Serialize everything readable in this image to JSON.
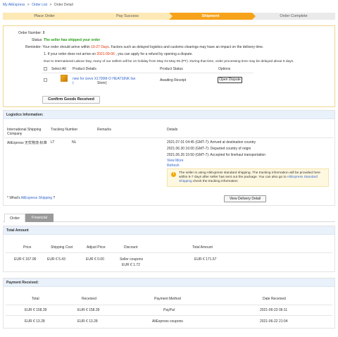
{
  "breadcrumb": [
    "My AliExpress",
    ">",
    "Order List",
    ">",
    "Order Detail"
  ],
  "steps": [
    {
      "label": "Place Order",
      "state": "done"
    },
    {
      "label": "Pay Success",
      "state": "done"
    },
    {
      "label": "Shipment",
      "state": "active"
    },
    {
      "label": "Order Complete",
      "state": "todo"
    }
  ],
  "order": {
    "number_label": "Order Number:",
    "number_value": "8",
    "status_label": "Status:",
    "status_value": "The seller has shipped your order",
    "reminder_label": "Reminder:",
    "reminder_pre": "Your order should arrive within ",
    "reminder_days": "19-27 Days",
    "reminder_post": ". Factors such as delayed logistics and customs clearings may have an impact on the delivery time.",
    "refund_pre": "1. If your order does not arrive on ",
    "refund_date": "2021-09-06",
    "refund_post": " , you can apply for a refund by opening a dispute.",
    "holiday_note": "Due to International Labour Day, many of our sellers will be on holiday from May 01-May 05 (PT). During that time, order processing time may be delayed about 5 days.",
    "confirm_button": "Confirm Goods Received"
  },
  "products": {
    "headers": [
      "Select All",
      "Product Details",
      "Product Status",
      "Options"
    ],
    "item": {
      "name_line1": "new for cievo X1700M-O HEATSINK fan",
      "name_line2": "(",
      "store": "Store)",
      "status": "Awaiting Receipt",
      "option_button": "Open Dispute"
    }
  },
  "logistics": {
    "title": "Logistics Information:",
    "headers": [
      "International Shipping Company",
      "Tracking Number",
      "Remarks",
      "Details"
    ],
    "company": "AliExpress 无忧物流-标准",
    "tracking_prefix": "LT",
    "tracking_suffix": "NL",
    "events": [
      "2021.07.01 04:45 (GMT-7): Arrived at destination country",
      "2021.06.30 16:00 (GMT-7): Departed country of origin",
      "2021.06.26 15:50 (GMT-7): Accepted for linehaul transportation"
    ],
    "view_more": "View More",
    "refresh": "Refresh",
    "tip_pre": "The seller is using AliExpress standard shipping. The tracking information will be provided here within 5-7 days after seller has sent out the package. You can also go to ",
    "tip_link": "AliExpress Standard Shipping",
    "tip_post": " check the tracking information",
    "whats_pre": "* What's ",
    "whats_link": "AliExpress Shipping",
    "whats_post": " ?",
    "view_delivery_button": "View Delivery Detail"
  },
  "tabs": [
    "Order",
    "Financial"
  ],
  "total_amount": {
    "title": "Total Amount",
    "headers": [
      "Price",
      "Shipping Cost",
      "Adjust Price",
      "Discount",
      "Total Amount"
    ],
    "price": "EUR € 167.96",
    "shipping": "EUR € 5.43",
    "adjust": "EUR € 0.00",
    "discount_line1": "Seller coupons",
    "discount_line2": "EUR € 1.72",
    "total": "EUR € 171.67"
  },
  "payment": {
    "title": "Payment Received:",
    "headers": [
      "Total",
      "Received",
      "Payment Method",
      "Date Received"
    ],
    "rows": [
      {
        "total": "EUR € 158.39",
        "received": "EUR € 158.39",
        "method": "PayPal",
        "date": "2021-06-23 06:11"
      },
      {
        "total": "EUR € 13.28",
        "received": "EUR € 13.28",
        "method": "AliExpress coupons",
        "date": "2021-06-22 21:04"
      }
    ]
  },
  "colors": {
    "step_active": "#f7a21b",
    "step_done": "#fde9b6",
    "link": "#3366cc",
    "status_green": "#2a9d1b",
    "red": "#e62e04"
  }
}
